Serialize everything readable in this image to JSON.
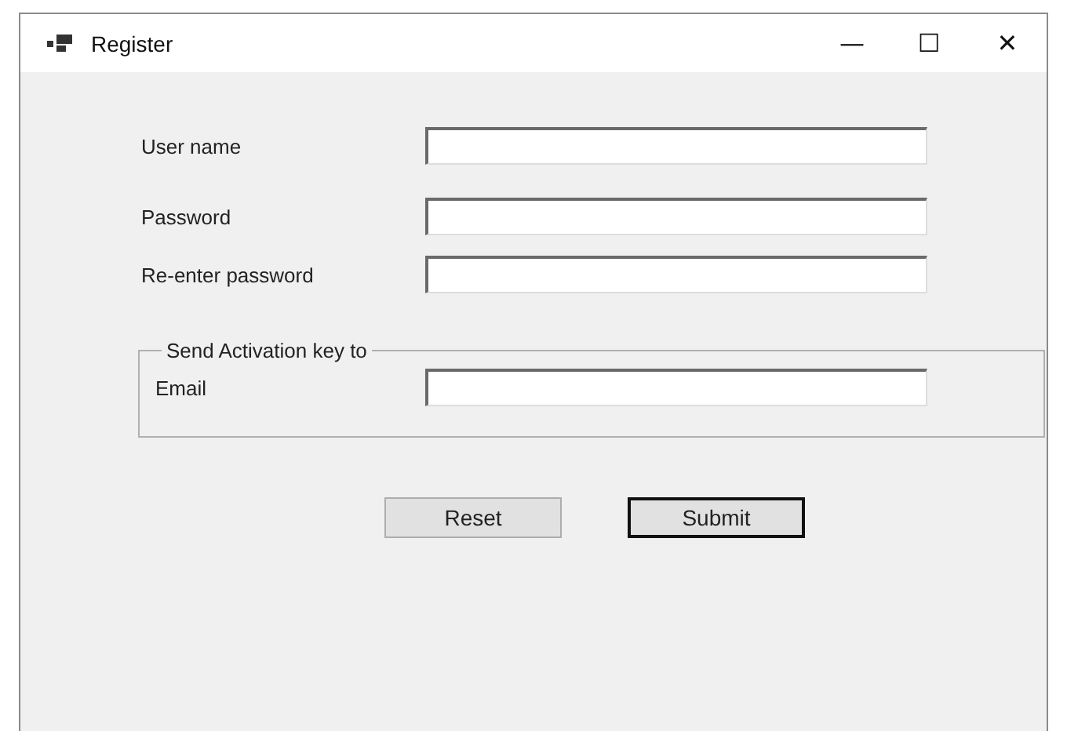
{
  "window": {
    "title": "Register",
    "controls": [
      "—",
      "☐",
      "✕"
    ]
  },
  "fields": [
    {
      "label": "User name"
    },
    {
      "label": "Password"
    },
    {
      "label": "Re-enter password"
    }
  ],
  "group": {
    "title": "Send Activation key to",
    "fields": [
      {
        "label": "Email"
      }
    ]
  },
  "buttons": [
    {
      "label": "Reset",
      "default": false
    },
    {
      "label": "Submit",
      "default": true
    }
  ]
}
